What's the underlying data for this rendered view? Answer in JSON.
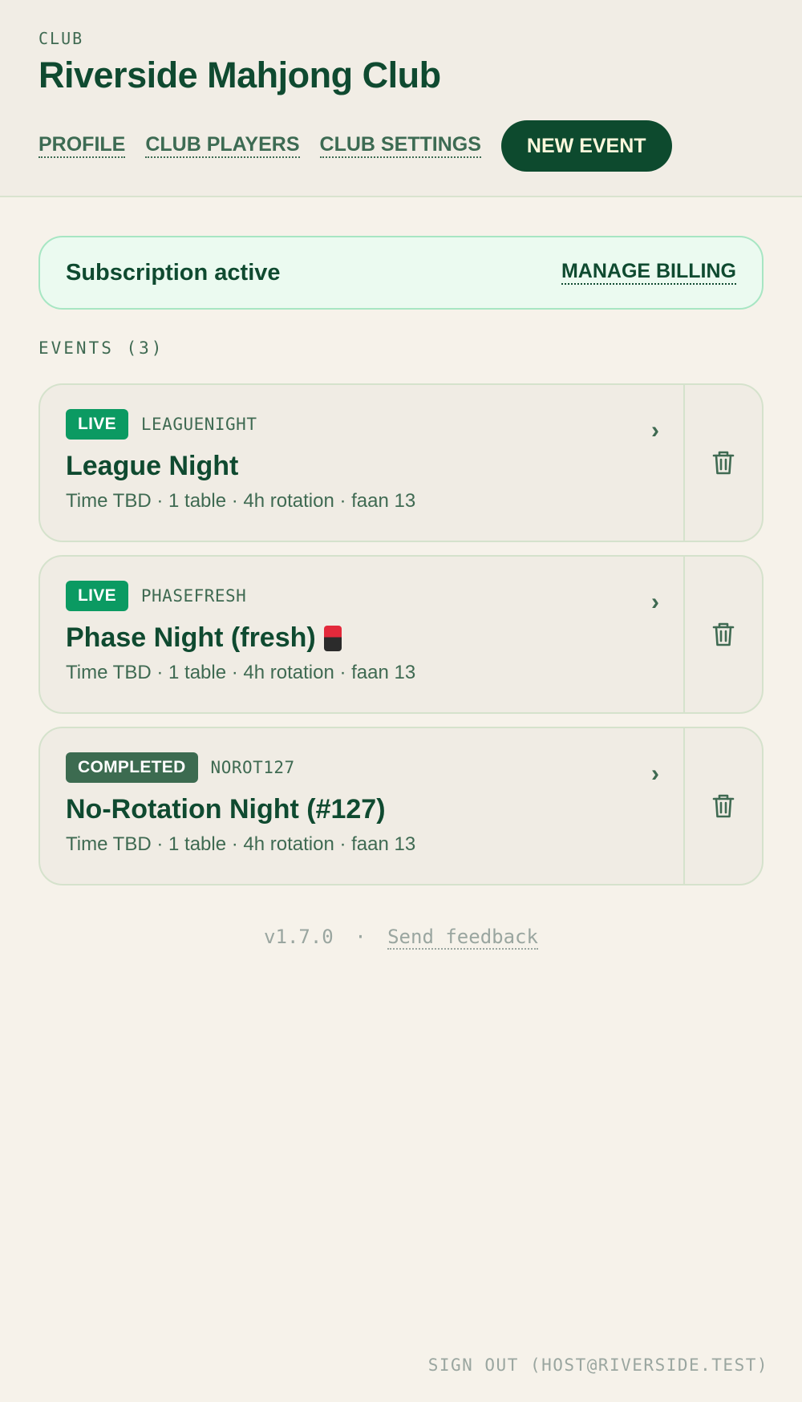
{
  "header": {
    "eyebrow": "CLUB",
    "title": "Riverside Mahjong Club",
    "nav": {
      "profile": "PROFILE",
      "club_players": "CLUB PLAYERS",
      "club_settings": "CLUB SETTINGS",
      "new_event": "NEW EVENT"
    }
  },
  "subscription": {
    "status": "Subscription active",
    "manage_billing": "MANAGE BILLING"
  },
  "events": {
    "heading": "EVENTS (3)",
    "items": [
      {
        "status": "LIVE",
        "code": "LEAGUENIGHT",
        "name": "League Night",
        "details": "Time TBD · 1 table · 4h rotation · faan 13"
      },
      {
        "status": "LIVE",
        "code": "PHASEFRESH",
        "name": "Phase Night (fresh)",
        "details": "Time TBD · 1 table · 4h rotation · faan 13"
      },
      {
        "status": "COMPLETED",
        "code": "NOROT127",
        "name": "No-Rotation Night (#127)",
        "details": "Time TBD · 1 table · 4h rotation · faan 13"
      }
    ]
  },
  "footer": {
    "version": "v1.7.0",
    "separator": "·",
    "feedback": "Send feedback",
    "sign_out": "SIGN OUT (HOST@RIVERSIDE.TEST)"
  },
  "icons": {
    "chevron": "chevron-right-icon",
    "delete": "trash-icon",
    "tile": "mahjong-red-dragon-icon"
  },
  "colors": {
    "primary": "#0d4a2e",
    "live": "#0b9a62",
    "completed": "#3c6b50",
    "subscription_bg": "#ebfaf0"
  }
}
